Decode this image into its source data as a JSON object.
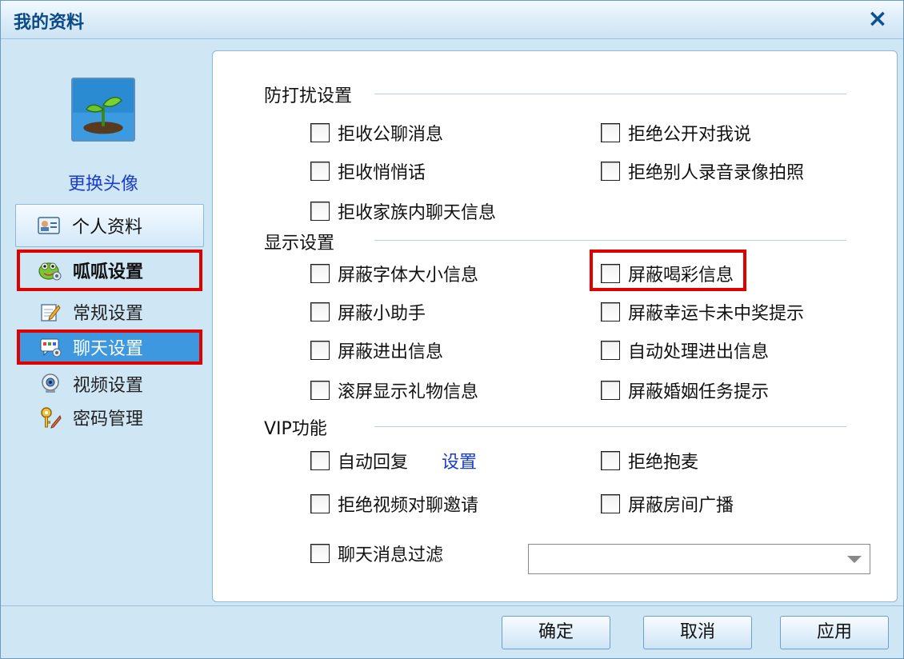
{
  "window": {
    "title": "我的资料",
    "close_icon": "×"
  },
  "sidebar": {
    "change_avatar": "更换头像",
    "profile": "个人资料",
    "guagua_settings": "呱呱设置",
    "general": "常规设置",
    "chat": "聊天设置",
    "video": "视频设置",
    "password": "密码管理"
  },
  "sections": {
    "dnd": "防打扰设置",
    "display": "显示设置",
    "vip": "VIP功能"
  },
  "options": {
    "reject_public_chat": "拒收公聊消息",
    "reject_public_to_me": "拒绝公开对我说",
    "reject_whisper": "拒收悄悄话",
    "reject_record": "拒绝别人录音录像拍照",
    "reject_family_chat": "拒收家族内聊天信息",
    "block_font_size": "屏蔽字体大小信息",
    "block_cheer": "屏蔽喝彩信息",
    "block_helper": "屏蔽小助手",
    "block_lucky_card": "屏蔽幸运卡未中奖提示",
    "block_inout": "屏蔽进出信息",
    "auto_inout": "自动处理进出信息",
    "scroll_gift": "滚屏显示礼物信息",
    "block_marriage": "屏蔽婚姻任务提示",
    "auto_reply": "自动回复",
    "auto_reply_link": "设置",
    "reject_mic": "拒绝抱麦",
    "reject_video_invite": "拒绝视频对聊邀请",
    "block_room_broadcast": "屏蔽房间广播",
    "chat_filter": "聊天消息过滤"
  },
  "filter_select": {
    "value": ""
  },
  "footer": {
    "ok": "确定",
    "cancel": "取消",
    "apply": "应用"
  },
  "colors": {
    "highlight": "#e00000",
    "link": "#1a3cc6",
    "accent": "#3d98df"
  }
}
